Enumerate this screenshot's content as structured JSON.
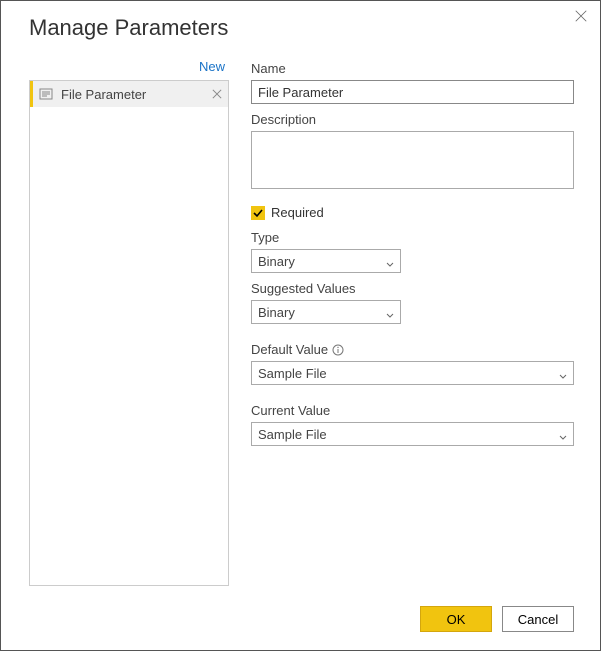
{
  "title": "Manage Parameters",
  "sidebar": {
    "new_label": "New",
    "items": [
      {
        "label": "File Parameter"
      }
    ]
  },
  "form": {
    "name_label": "Name",
    "name_value": "File Parameter",
    "description_label": "Description",
    "description_value": "",
    "required_label": "Required",
    "required_checked": true,
    "type_label": "Type",
    "type_value": "Binary",
    "suggested_label": "Suggested Values",
    "suggested_value": "Binary",
    "default_label": "Default Value",
    "default_value": "Sample File",
    "current_label": "Current Value",
    "current_value": "Sample File"
  },
  "footer": {
    "ok": "OK",
    "cancel": "Cancel"
  }
}
